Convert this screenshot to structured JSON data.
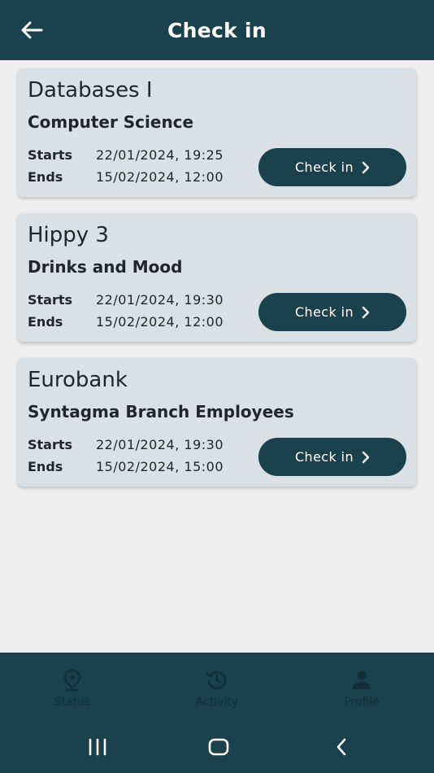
{
  "header": {
    "title": "Check in",
    "back_icon": "arrow-left-icon"
  },
  "events": [
    {
      "title": "Databases I",
      "subtitle": "Computer Science",
      "starts_label": "Starts",
      "starts_value": "22/01/2024, 19:25",
      "ends_label": "Ends",
      "ends_value": "15/02/2024, 12:00",
      "button_label": "Check in"
    },
    {
      "title": "Hippy 3",
      "subtitle": "Drinks and Mood",
      "starts_label": "Starts",
      "starts_value": "22/01/2024, 19:30",
      "ends_label": "Ends",
      "ends_value": "15/02/2024, 12:00",
      "button_label": "Check in"
    },
    {
      "title": "Eurobank",
      "subtitle": "Syntagma Branch Employees",
      "starts_label": "Starts",
      "starts_value": "22/01/2024, 19:30",
      "ends_label": "Ends",
      "ends_value": "15/02/2024, 15:00",
      "button_label": "Check in"
    }
  ],
  "bottom_nav": {
    "items": [
      {
        "label": "Status",
        "icon": "location-pin-icon"
      },
      {
        "label": "Activity",
        "icon": "history-icon"
      },
      {
        "label": "Profile",
        "icon": "person-icon"
      }
    ]
  },
  "system_nav": {
    "recents_icon": "recents-icon",
    "home_icon": "home-icon",
    "back_icon": "back-chevron-icon"
  },
  "colors": {
    "primary": "#1a414c",
    "card_bg": "#dae0e4",
    "page_bg": "#efefef",
    "text": "#23252a",
    "nav_inactive": "#132f37"
  }
}
